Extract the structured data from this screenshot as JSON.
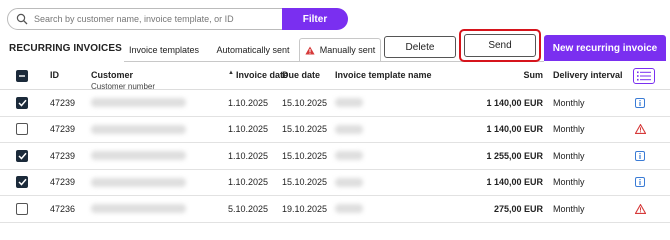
{
  "search": {
    "placeholder": "Search by customer name, invoice template, or ID",
    "value": ""
  },
  "filter_label": "Filter",
  "section_title": "RECURRING INVOICES",
  "tabs": [
    {
      "label": "Invoice templates"
    },
    {
      "label": "Automatically sent"
    },
    {
      "label": "Manually sent",
      "icon": "warning-icon"
    }
  ],
  "actions": {
    "delete_label": "Delete",
    "send_label": "Send",
    "new_label": "New recurring invoice"
  },
  "table": {
    "headers": {
      "id": "ID",
      "customer": "Customer",
      "customer_sub": "Customer number",
      "invoice_date": "Invoice date",
      "due_date": "Due date",
      "template": "Invoice template name",
      "sum": "Sum",
      "interval": "Delivery interval"
    },
    "rows": [
      {
        "checked": true,
        "id": "47239",
        "invoice_date": "1.10.2025",
        "due_date": "15.10.2025",
        "sum": "1 140,00 EUR",
        "interval": "Monthly",
        "status_icon": "info-icon"
      },
      {
        "checked": false,
        "id": "47239",
        "invoice_date": "1.10.2025",
        "due_date": "15.10.2025",
        "sum": "1 140,00 EUR",
        "interval": "Monthly",
        "status_icon": "warning-icon"
      },
      {
        "checked": true,
        "id": "47239",
        "invoice_date": "1.10.2025",
        "due_date": "15.10.2025",
        "sum": "1 255,00 EUR",
        "interval": "Monthly",
        "status_icon": "info-icon"
      },
      {
        "checked": true,
        "id": "47239",
        "invoice_date": "1.10.2025",
        "due_date": "15.10.2025",
        "sum": "1 140,00 EUR",
        "interval": "Monthly",
        "status_icon": "info-icon"
      },
      {
        "checked": false,
        "id": "47236",
        "invoice_date": "5.10.2025",
        "due_date": "19.10.2025",
        "sum": "275,00 EUR",
        "interval": "Monthly",
        "status_icon": "warning-icon"
      }
    ]
  },
  "colors": {
    "accent": "#7a2ff0",
    "highlight": "#d6141c",
    "warning": "#d63a3a",
    "info": "#3a7bd5"
  }
}
